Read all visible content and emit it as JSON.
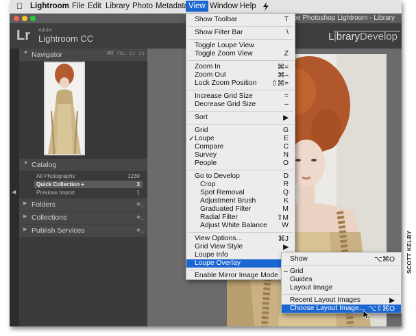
{
  "menubar": {
    "apple_icon": "apple-logo-icon",
    "items": [
      "Lightroom",
      "File",
      "Edit",
      "Library",
      "Photo",
      "Metadata",
      "View",
      "Window",
      "Help"
    ],
    "active": "View",
    "script_icon": "script-menu-icon"
  },
  "window": {
    "title": "- Adobe Photoshop Lightroom - Library"
  },
  "lr": {
    "logo": "Lr",
    "adobe": "Adobe",
    "app_name": "Lightroom CC",
    "modules": [
      "Library",
      "Develop"
    ]
  },
  "navigator": {
    "title": "Navigator",
    "options": [
      "FIT",
      "FILL",
      "1:1",
      "2:1"
    ],
    "selected_option": "FIT"
  },
  "catalog": {
    "title": "Catalog",
    "rows": [
      {
        "name": "All Photographs",
        "count": "1230"
      },
      {
        "name": "Quick Collection +",
        "count": "3"
      },
      {
        "name": "Previous Import",
        "count": "1"
      }
    ]
  },
  "panels": {
    "folders": "Folders",
    "collections": "Collections",
    "publish": "Publish Services",
    "plus": "+."
  },
  "view_menu": {
    "items": [
      {
        "label": "Show Toolbar",
        "shortcut": "T"
      },
      {
        "label": "Show Filter Bar",
        "shortcut": "\\"
      },
      {
        "label": "Toggle Loupe View",
        "shortcut": ""
      },
      {
        "label": "Toggle Zoom View",
        "shortcut": "Z"
      },
      {
        "label": "Zoom In",
        "shortcut": "⌘="
      },
      {
        "label": "Zoom Out",
        "shortcut": "⌘–"
      },
      {
        "label": "Lock Zoom Position",
        "shortcut": "⇧⌘="
      },
      {
        "label": "Increase Grid Size",
        "shortcut": "="
      },
      {
        "label": "Decrease Grid Size",
        "shortcut": "–"
      },
      {
        "label": "Sort",
        "shortcut": "▶"
      },
      {
        "label": "Grid",
        "shortcut": "G"
      },
      {
        "label": "Loupe",
        "shortcut": "E",
        "check": "✓"
      },
      {
        "label": "Compare",
        "shortcut": "C"
      },
      {
        "label": "Survey",
        "shortcut": "N"
      },
      {
        "label": "People",
        "shortcut": "O"
      },
      {
        "label": "Go to Develop",
        "shortcut": "D"
      },
      {
        "label": "Crop",
        "shortcut": "R"
      },
      {
        "label": "Spot Removal",
        "shortcut": "Q"
      },
      {
        "label": "Adjustment Brush",
        "shortcut": "K"
      },
      {
        "label": "Graduated Filter",
        "shortcut": "M"
      },
      {
        "label": "Radial Filter",
        "shortcut": "⇧M"
      },
      {
        "label": "Adjust White Balance",
        "shortcut": "W"
      },
      {
        "label": "View Options...",
        "shortcut": "⌘J"
      },
      {
        "label": "Grid View Style",
        "shortcut": "▶"
      },
      {
        "label": "Loupe Info",
        "shortcut": "▶"
      },
      {
        "label": "Loupe Overlay",
        "shortcut": "▶"
      },
      {
        "label": "Enable Mirror Image Mode",
        "shortcut": ""
      }
    ]
  },
  "overlay_submenu": {
    "items": [
      {
        "label": "Show",
        "shortcut": "⌥⌘O"
      },
      {
        "label": "Grid",
        "shortcut": "",
        "check": "–"
      },
      {
        "label": "Guides",
        "shortcut": ""
      },
      {
        "label": "Layout Image",
        "shortcut": ""
      },
      {
        "label": "Recent Layout Images",
        "shortcut": "▶"
      },
      {
        "label": "Choose Layout Image...",
        "shortcut": "⌥⇧⌘O"
      }
    ]
  },
  "credit": "SCOTT KELBY",
  "colors": {
    "menu_highlight": "#1a66d2",
    "panel_bg": "#3a3a3a",
    "header_bg": "#3e3e3e"
  }
}
